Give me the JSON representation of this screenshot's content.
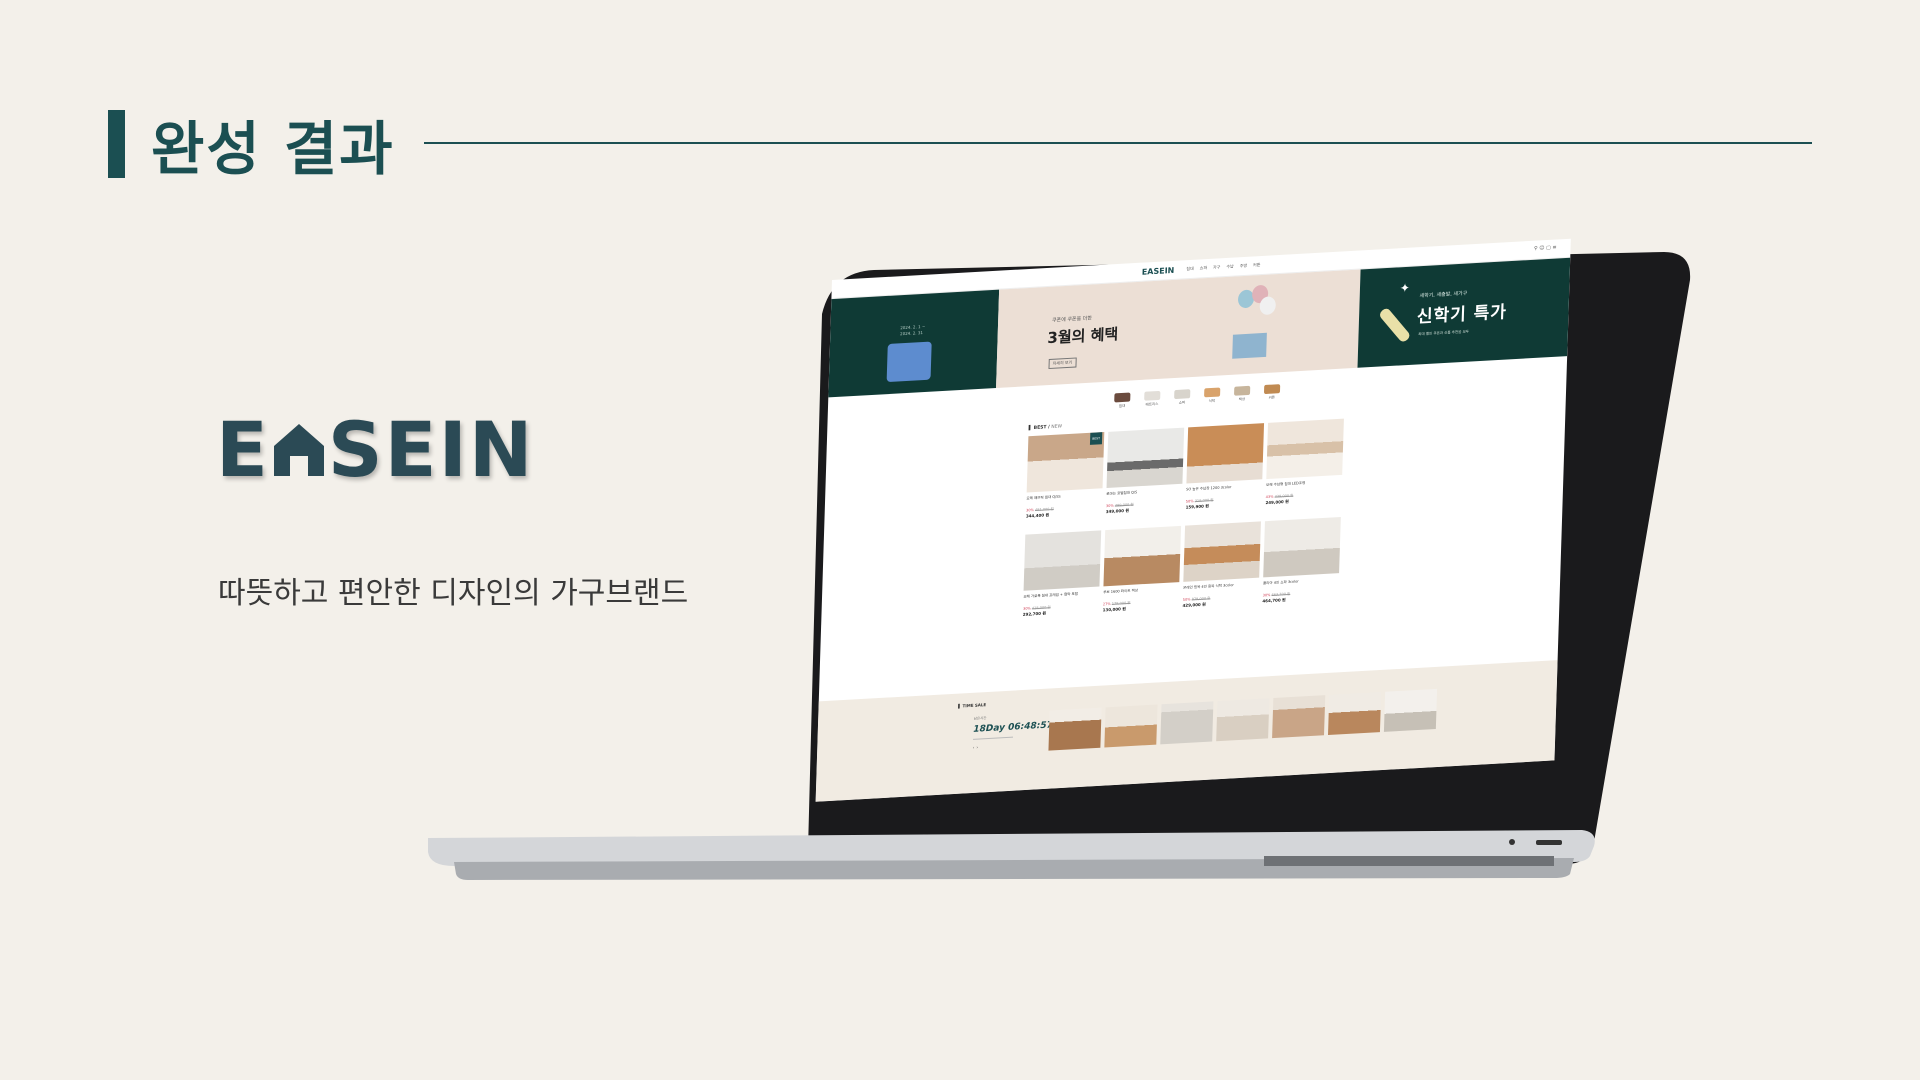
{
  "heading": {
    "title": "완성 결과"
  },
  "brand": {
    "logo_left": "E",
    "logo_right": "SEIN",
    "tagline": "따뜻하고 편안한 디자인의 가구브랜드"
  },
  "site": {
    "logo": "EASEIN",
    "menu": [
      "침대",
      "쇼파",
      "가구",
      "수납",
      "주방",
      "커튼"
    ],
    "banner_left": {
      "date_from": "2024. 2. 1 ~",
      "date_to": "2024. 2. 31"
    },
    "banner_mid": {
      "sub": "쿠폰에 쿠폰을 더한",
      "headline": "3월의 혜택",
      "button": "자세히 보기"
    },
    "banner_right": {
      "sub": "새학기, 새출발, 새가구",
      "headline": "신학기 특가",
      "note": "최대 할인 쿠폰과 신품 추천을 모두"
    },
    "categories": [
      "침대",
      "매트리스",
      "쇼파",
      "식탁",
      "책상",
      "커튼"
    ],
    "section_title": "BEST",
    "section_new": "NEW",
    "best_badge": "BEST",
    "products": [
      {
        "name": "모헤 패브릭 침대 Q/SS",
        "disc": "30%",
        "orig": "491,000 원",
        "price": "344,400 원"
      },
      {
        "name": "로마는 호텔침대 Q/S",
        "disc": "30%",
        "orig": "499,000 원",
        "price": "349,000 원"
      },
      {
        "name": "SO 높은 수납장 1200 3color",
        "disc": "50%",
        "orig": "319,000 원",
        "price": "159,900 원"
      },
      {
        "name": "모헤 수납형 침대 LED조명",
        "disc": "43%",
        "orig": "439,000 원",
        "price": "249,000 원"
      },
      {
        "name": "모헤 가로폭 침대 프레임 + 협탁 포함",
        "disc": "30%",
        "orig": "418,000 원",
        "price": "292,700 원"
      },
      {
        "name": "루보 1600 화이트 책상",
        "disc": "27%",
        "orig": "179,000 원",
        "price": "130,000 원"
      },
      {
        "name": "온레인 원목 4인 원목 식탁 3color",
        "disc": "50%",
        "orig": "879,000 원",
        "price": "429,000 원"
      },
      {
        "name": "폴리아 4인 쇼파 3color",
        "disc": "30%",
        "orig": "663,700 원",
        "price": "464,700 원"
      }
    ],
    "timesale": {
      "title": "TIME SALE",
      "sub": "남은시간",
      "timer": "18Day 06:48:57"
    }
  },
  "colors": {
    "accent": "#1b4f52",
    "background": "#f3f0ea",
    "banner_dark": "#0f3a35"
  }
}
